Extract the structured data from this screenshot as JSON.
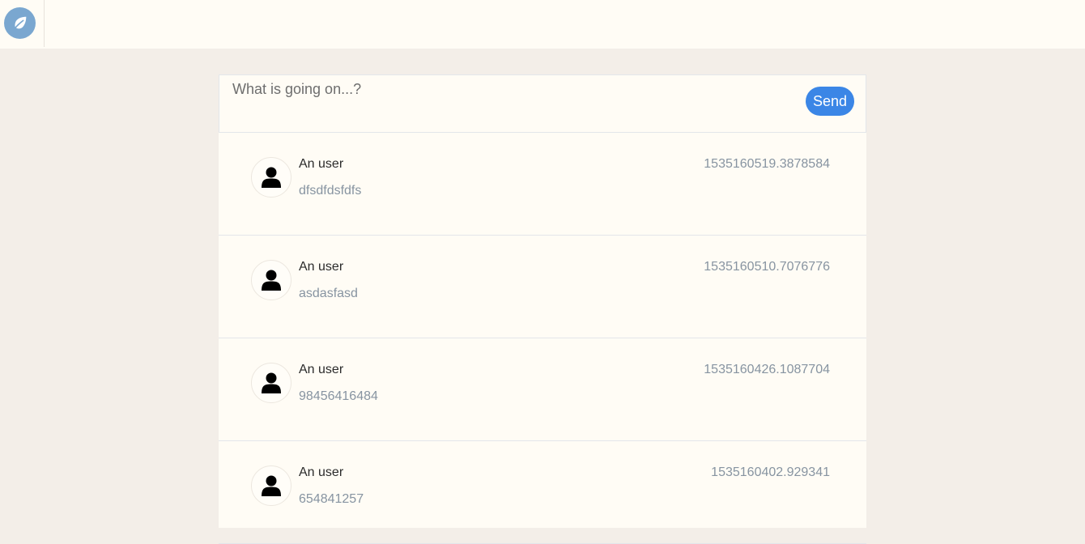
{
  "header": {
    "logo_icon": "leaf-icon",
    "logo_color": "#7aa7d0"
  },
  "composer": {
    "placeholder": "What is going on...?",
    "value": "",
    "send_label": "Send",
    "send_color": "#3b86e6"
  },
  "posts": [
    {
      "author": "An user",
      "timestamp": "1535160519.3878584",
      "text": "dfsdfdsfdfs",
      "avatar_icon": "user-icon"
    },
    {
      "author": "An user",
      "timestamp": "1535160510.7076776",
      "text": "asdasfasd",
      "avatar_icon": "user-icon"
    },
    {
      "author": "An user",
      "timestamp": "1535160426.1087704",
      "text": "98456416484",
      "avatar_icon": "user-icon"
    },
    {
      "author": "An user",
      "timestamp": "1535160402.929341",
      "text": "654841257",
      "avatar_icon": "user-icon"
    }
  ]
}
